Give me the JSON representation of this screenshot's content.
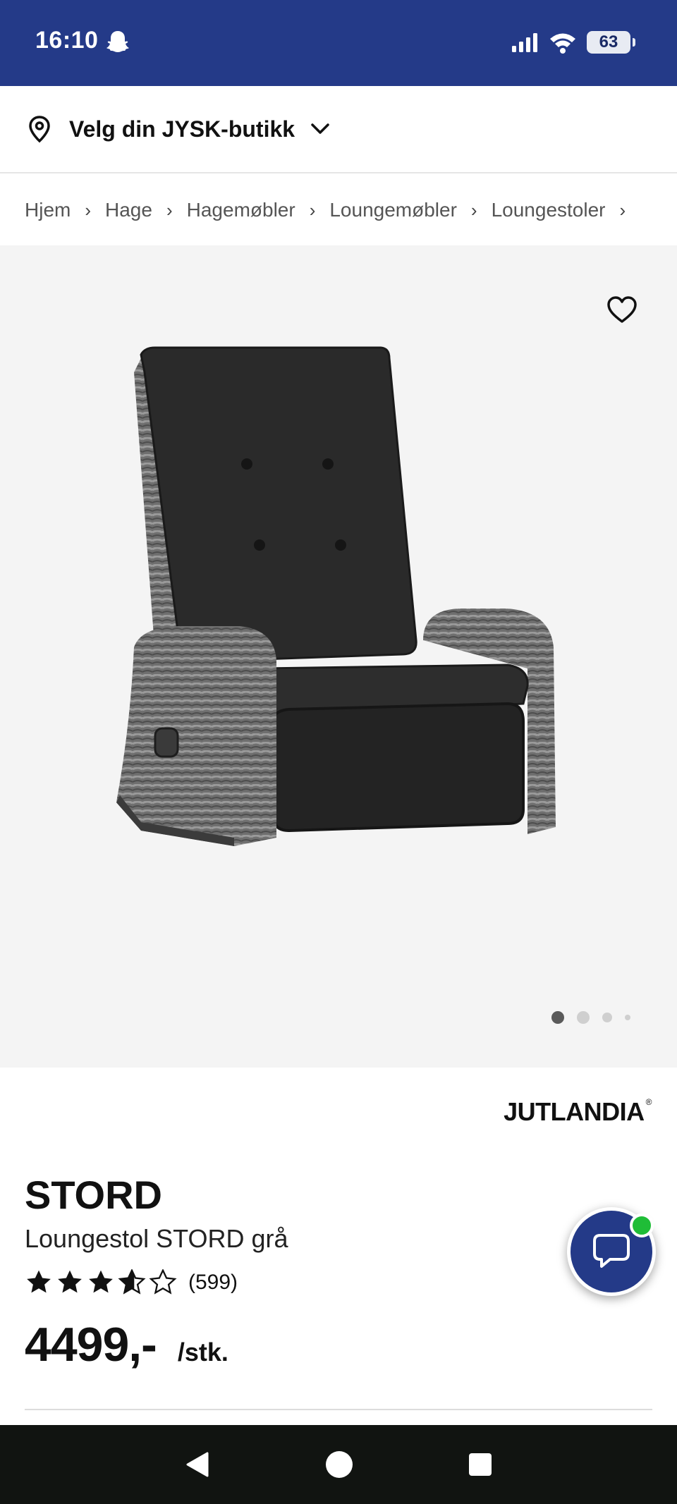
{
  "status_bar": {
    "time": "16:10",
    "battery": "63",
    "icons": [
      "snapchat-ghost-icon",
      "signal-icon",
      "wifi-icon",
      "battery-icon"
    ],
    "background_color": "#243a88"
  },
  "store_selector": {
    "label": "Velg din JYSK-butikk",
    "icons": [
      "location-pin-icon",
      "chevron-down-icon"
    ]
  },
  "breadcrumb": {
    "items": [
      "Hjem",
      "Hage",
      "Hagemøbler",
      "Loungemøbler",
      "Loungestoler"
    ]
  },
  "gallery": {
    "image_count": 4,
    "active_index": 0,
    "icons": [
      "heart-icon"
    ]
  },
  "product": {
    "brand": "JUTLANDIA",
    "brand_mark": "®",
    "name": "STORD",
    "subtitle": "Loungestol STORD grå",
    "rating": 3.5,
    "rating_max": 5,
    "review_count": "(599)",
    "price": "4499,-",
    "price_unit": "/stk."
  },
  "chat": {
    "icon": "chat-bubble-icon",
    "badge_color": "#1fbd37"
  },
  "nav_bar": {
    "icons": [
      "back-triangle-icon",
      "home-circle-icon",
      "recents-square-icon"
    ]
  }
}
